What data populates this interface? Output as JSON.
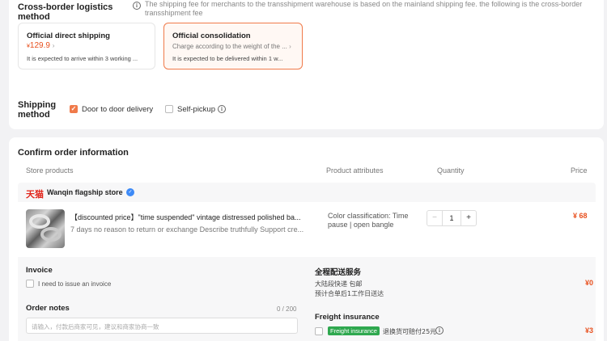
{
  "logistics": {
    "title": "Cross-border logistics method",
    "note": "The shipping fee for merchants to the transshipment warehouse is based on the mainland shipping fee. the following is the cross-border transshipment fee",
    "options": [
      {
        "title": "Official direct shipping",
        "price": "129.9",
        "currency": "¥",
        "foot": "It is expected to arrive within 3 working ...",
        "selected": false
      },
      {
        "title": "Official consolidation",
        "sub": "Charge according to the weight of the ...",
        "foot": "It is expected to be delivered within 1 w...",
        "selected": true
      }
    ]
  },
  "shipping": {
    "title_line1": "Shipping",
    "title_line2": "method",
    "door": {
      "label": "Door to door delivery",
      "checked": true
    },
    "pickup": {
      "label": "Self-pickup",
      "checked": false
    }
  },
  "order": {
    "title": "Confirm order information",
    "columns": {
      "store": "Store products",
      "attrs": "Product attributes",
      "qty": "Quantity",
      "price": "Price"
    },
    "store": {
      "logo": "天猫",
      "name": "Wanqin flagship store"
    },
    "product": {
      "name": "【discounted price】\"time suspended\" vintage distressed polished ba...",
      "tags": "7 days no reason to return or exchange   Describe truthfully   Support cre...",
      "attrs": "Color classification: Time pause | open bangle",
      "qty": "1",
      "price": "¥ 68"
    },
    "invoice": {
      "title": "Invoice",
      "label": "I need to issue an invoice"
    },
    "notes": {
      "title": "Order notes",
      "count": "0 / 200",
      "placeholder": "请输入，付款后商家可见，建议和商家协商一致"
    },
    "delivery": {
      "title": "全程配送服务",
      "line1": "大陆段快递 包邮",
      "line2": "预计合单后1工作日送达",
      "price": "¥0"
    },
    "freight": {
      "title": "Freight insurance",
      "tag": "Freight insurance",
      "desc": "退换货可赔付25元",
      "price": "¥3"
    }
  },
  "colors": {
    "accent": "#f07a4a",
    "price": "#e8501e",
    "tmall": "#e1251b",
    "insurance": "#2fa84f"
  }
}
